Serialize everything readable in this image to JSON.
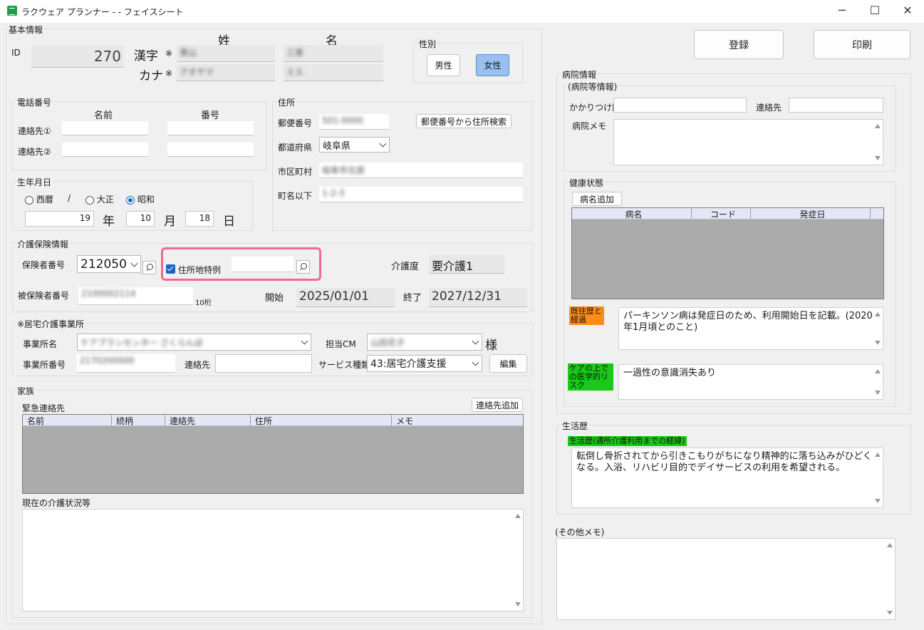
{
  "window": {
    "title": "ラクウェア プランナー -  - フェイスシート",
    "minimize": "─",
    "maximize": "☐",
    "close": "✕"
  },
  "basic": {
    "section": "基本情報",
    "id_label": "ID",
    "id_value": "270",
    "sei": "姓",
    "mei": "名",
    "kanji_label": "漢字",
    "kana_label": "カナ",
    "req": "※",
    "kanji_sei": "青山",
    "kanji_mei": "三恵",
    "kana_sei": "アオヤマ",
    "kana_mei": "ミエ",
    "gender_label": "性別",
    "male": "男性",
    "female": "女性"
  },
  "actions": {
    "register": "登録",
    "print": "印刷"
  },
  "phone": {
    "section": "電話番号",
    "name_col": "名前",
    "number_col": "番号",
    "contact1": "連絡先①",
    "contact2": "連絡先②"
  },
  "birth": {
    "section": "生年月日",
    "seireki": "西暦",
    "slash": "/",
    "taisho": "大正",
    "showa": "昭和",
    "year": "19",
    "year_unit": "年",
    "month": "10",
    "month_unit": "月",
    "day": "18",
    "day_unit": "日"
  },
  "address": {
    "section": "住所",
    "postal_label": "郵便番号",
    "postal_value": "501-0000",
    "search_btn": "郵便番号から住所検索",
    "pref_label": "都道府県",
    "pref_value": "岐阜県",
    "city_label": "市区町村",
    "city_value": "岐阜市北部",
    "town_label": "町名以下",
    "town_value": "1-2-3"
  },
  "insurance": {
    "section": "介護保険情報",
    "insurer_label": "保険者番号",
    "insurer_value": "212050",
    "tokurei_label": "住所地特例",
    "care_level_label": "介護度",
    "care_level_value": "要介護1",
    "insured_label": "被保険者番号",
    "insured_value": "2100002114",
    "digits": "10桁",
    "start_label": "開始",
    "start_value": "2025/01/01",
    "end_label": "終了",
    "end_value": "2027/12/31"
  },
  "office": {
    "section": "※居宅介護事業所",
    "name_label": "事業所名",
    "name_value": "ケアプランセンター さくらんぼ",
    "cm_label": "担当CM",
    "cm_value": "山田花子",
    "sama": "様",
    "number_label": "事業所番号",
    "number_value": "2170200000",
    "contact_label": "連絡先",
    "service_label": "サービス種類",
    "service_value": "43:居宅介護支援",
    "edit_btn": "編集"
  },
  "family": {
    "section": "家族",
    "emergency_label": "緊急連絡先",
    "add_contact_btn": "連絡先追加",
    "columns": [
      "名前",
      "続柄",
      "連絡先",
      "住所",
      "メモ"
    ],
    "care_status_label": "現在の介護状況等"
  },
  "hospital": {
    "section": "病院情報",
    "sub_section": "(病院等情報)",
    "doctor_label": "かかりつけ医",
    "contact_label": "連絡先",
    "memo_label": "病院メモ"
  },
  "health": {
    "section": "健康状態",
    "add_disease_btn": "病名追加",
    "columns": [
      "病名",
      "コード",
      "発症日"
    ],
    "history_label": "既往歴と経過",
    "history_text": "パーキンソン病は発症日のため、利用開始日を記載。(2020年1月頃とのこと)",
    "risk_label": "ケアの上での医学的リスク",
    "risk_text": "一過性の意識消失あり"
  },
  "life": {
    "section": "生活歴",
    "sub_label": "生活歴(通所介護利用までの経緯)",
    "text": "転倒し骨折されてから引きこもりがちになり精神的に落ち込みがひどくなる。入浴、リハビリ目的でデイサービスの利用を希望される。"
  },
  "other": {
    "label": "(その他メモ)"
  },
  "colors": {
    "accent": "#1a64c8",
    "highlight_box": "#f06a8e",
    "orange_label": "#ff8c19",
    "green_label": "#19c819",
    "selected_btn": "#99c0f0"
  }
}
